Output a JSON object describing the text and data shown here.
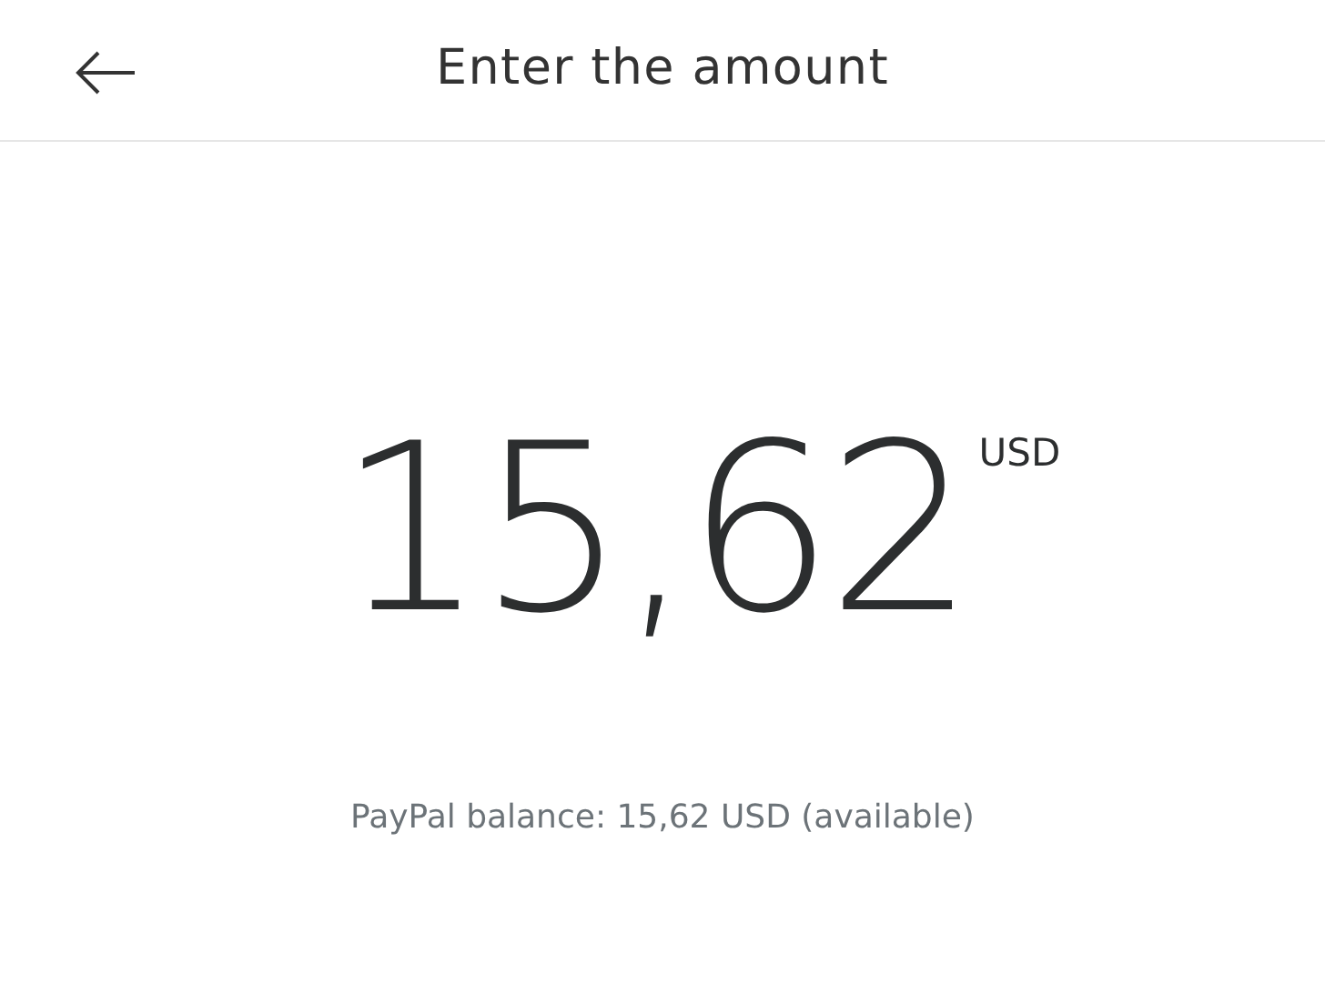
{
  "header": {
    "title": "Enter the amount"
  },
  "amount": {
    "value": "15,62",
    "currency": "USD"
  },
  "balance": "PayPal balance: 15,62 USD (available)"
}
